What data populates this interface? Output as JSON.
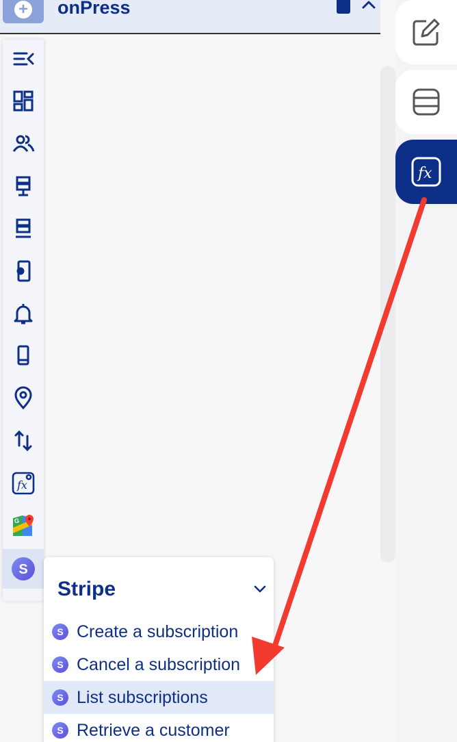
{
  "app": {
    "brand": "onPress",
    "add_symbol": "+"
  },
  "toolbar": {
    "items": [
      {
        "icon": "menu-collapse-icon"
      },
      {
        "icon": "dashboard-icon"
      },
      {
        "icon": "users-icon"
      },
      {
        "icon": "server-icon"
      },
      {
        "icon": "server-error-icon"
      },
      {
        "icon": "device-settings-icon"
      },
      {
        "icon": "bell-icon"
      },
      {
        "icon": "mobile-icon"
      },
      {
        "icon": "location-pin-icon"
      },
      {
        "icon": "sort-arrows-icon"
      },
      {
        "icon": "function-add-icon"
      },
      {
        "icon": "google-maps-icon"
      },
      {
        "icon": "stripe-icon"
      }
    ]
  },
  "right_rail": {
    "buttons": [
      {
        "icon": "edit-icon"
      },
      {
        "icon": "database-icon"
      },
      {
        "icon": "function-icon",
        "selected": true
      }
    ]
  },
  "stripe_menu": {
    "title": "Stripe",
    "badge": "S",
    "items": [
      {
        "label": "Create a subscription"
      },
      {
        "label": "Cancel a subscription"
      },
      {
        "label": "List subscriptions",
        "highlighted": true
      },
      {
        "label": "Retrieve a customer"
      }
    ]
  },
  "colors": {
    "brand": "#0d2f87",
    "annotation_arrow": "#f23a2f",
    "highlight": "#e1e8f8"
  }
}
